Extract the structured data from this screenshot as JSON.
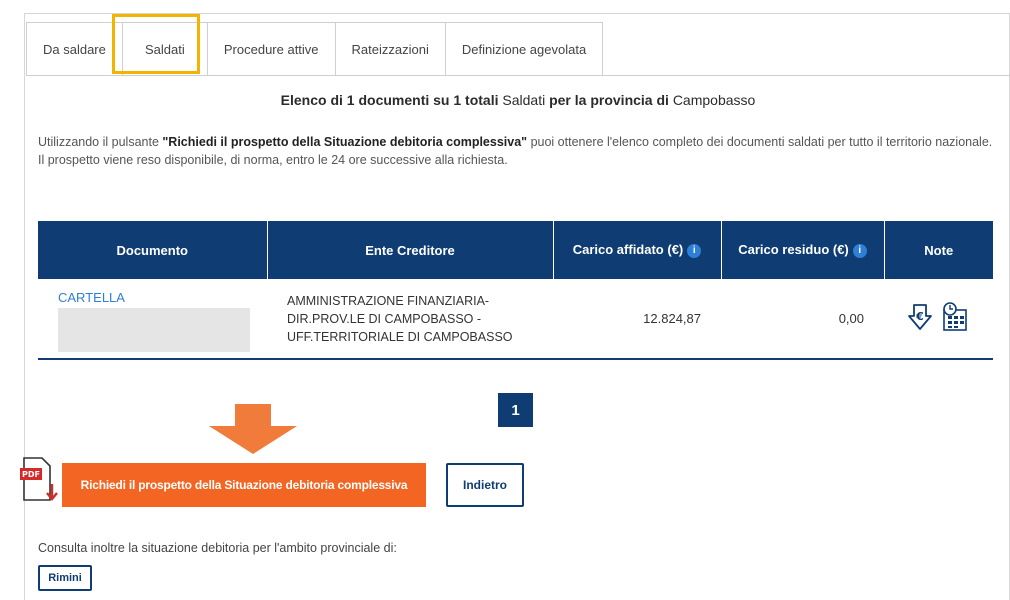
{
  "tabs": [
    {
      "label": "Da saldare"
    },
    {
      "label": "Saldati"
    },
    {
      "label": "Procedure attive"
    },
    {
      "label": "Rateizzazioni"
    },
    {
      "label": "Definizione agevolata"
    }
  ],
  "heading": {
    "prefix": "Elenco di 1 documenti su 1 totali",
    "status": "Saldati",
    "middle": "per la provincia di",
    "province": "Campobasso"
  },
  "info": {
    "line1_prefix": "Utilizzando il pulsante ",
    "line1_bold": "\"Richiedi il prospetto della Situazione debitoria complessiva\"",
    "line1_suffix": " puoi ottenere l'elenco completo dei documenti saldati per tutto il territorio nazionale.",
    "line2": "Il prospetto viene reso disponibile, di norma, entro le 24 ore successive alla richiesta."
  },
  "table": {
    "headers": [
      "Documento",
      "Ente Creditore",
      "Carico affidato (€)",
      "Carico residuo (€)",
      "Note"
    ],
    "info_glyph": "i",
    "rows": [
      {
        "documento": "CARTELLA",
        "ente_line1": "AMMINISTRAZIONE FINANZIARIA-",
        "ente_line2": "DIR.PROV.LE DI CAMPOBASSO -",
        "ente_line3": "UFF.TERRITORIALE DI CAMPOBASSO",
        "carico_affidato": "12.824,87",
        "carico_residuo": "0,00",
        "note_icons": [
          "euro-download-icon",
          "calculator-schedule-icon"
        ]
      }
    ]
  },
  "pagination": {
    "current": "1"
  },
  "actions": {
    "pdf_label": "PDF",
    "request_button": "Richiedi il prospetto della Situazione debitoria complessiva",
    "back_button": "Indietro"
  },
  "footer": {
    "consulta_text": "Consulta inoltre la situazione debitoria per l'ambito provinciale di:",
    "province_button": "Rimini"
  },
  "colors": {
    "header_blue": "#0f3d73",
    "orange": "#f26522",
    "highlight": "#f2b400",
    "link": "#2f7fd6"
  }
}
